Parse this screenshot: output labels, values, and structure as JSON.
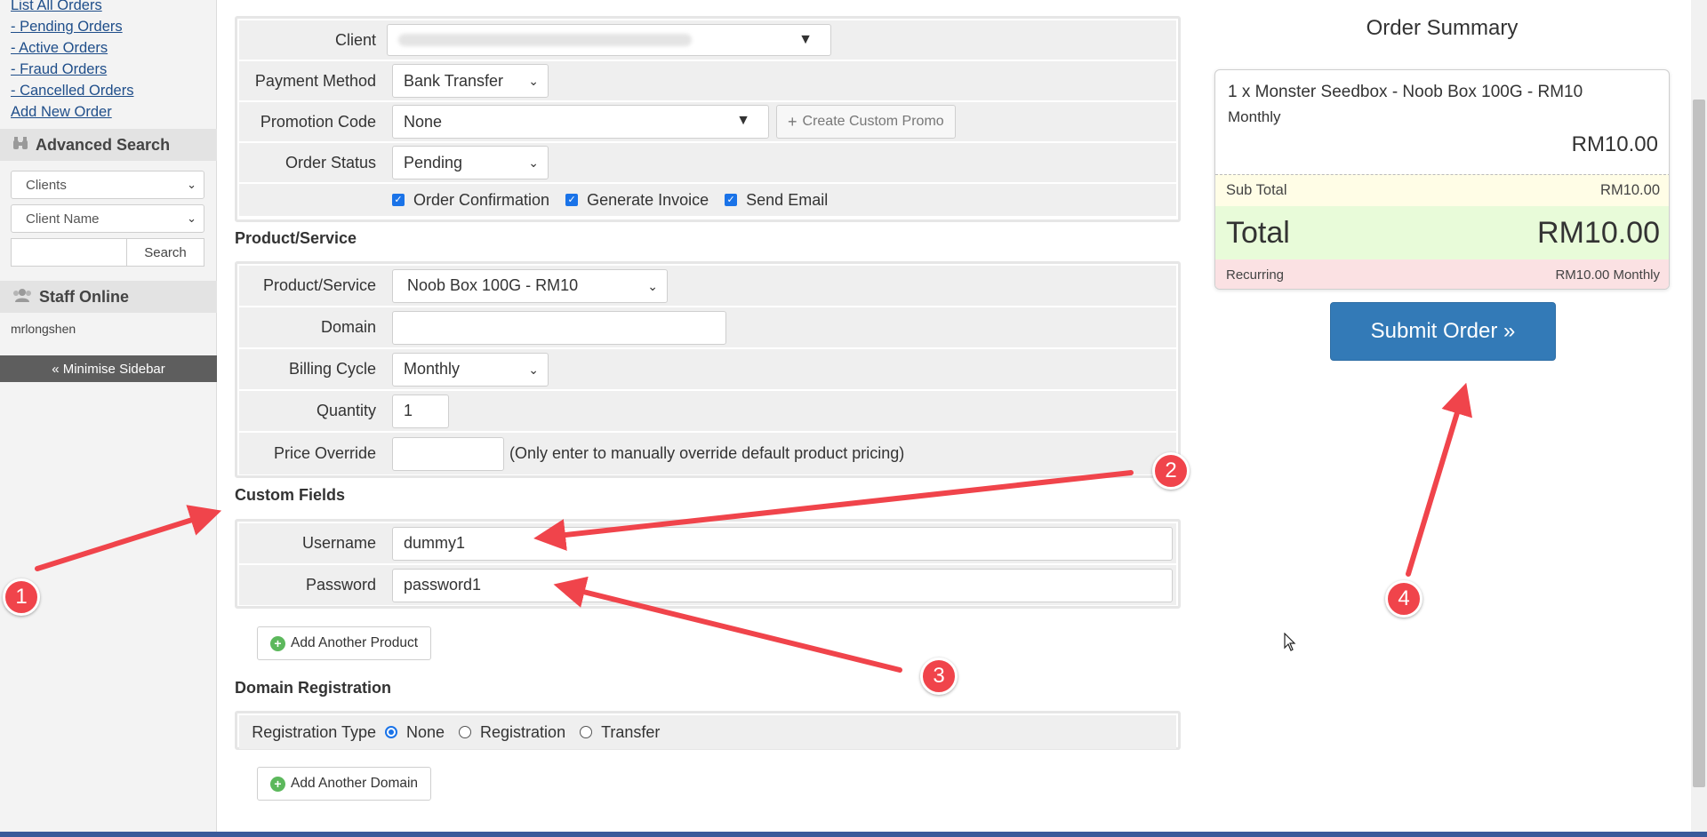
{
  "sidebar": {
    "links": [
      "List All Orders",
      "- Pending Orders",
      "- Active Orders",
      "- Fraud Orders",
      "- Cancelled Orders",
      "Add New Order"
    ],
    "advanced_search": "Advanced Search",
    "search_type": "Clients",
    "search_field": "Client Name",
    "search_button": "Search",
    "staff_online": "Staff Online",
    "staff_user": "mrlongshen",
    "minimise": "« Minimise Sidebar"
  },
  "form": {
    "client_label": "Client",
    "payment_label": "Payment Method",
    "payment_value": "Bank Transfer",
    "promo_label": "Promotion Code",
    "promo_value": "None",
    "custom_promo": "Create Custom Promo",
    "status_label": "Order Status",
    "status_value": "Pending",
    "checks": [
      "Order Confirmation",
      "Generate Invoice",
      "Send Email"
    ]
  },
  "product": {
    "section": "Product/Service",
    "product_label": "Product/Service",
    "product_value": "Noob Box 100G - RM10",
    "domain_label": "Domain",
    "billing_label": "Billing Cycle",
    "billing_value": "Monthly",
    "quantity_label": "Quantity",
    "quantity_value": "1",
    "override_label": "Price Override",
    "override_note": "(Only enter to manually override default product pricing)"
  },
  "custom_fields": {
    "section": "Custom Fields",
    "username_label": "Username",
    "username_value": "dummy1",
    "password_label": "Password",
    "password_value": "password1"
  },
  "add_product": "Add Another Product",
  "domain_reg": {
    "section": "Domain Registration",
    "type_label": "Registration Type",
    "options": [
      "None",
      "Registration",
      "Transfer"
    ]
  },
  "add_domain": "Add Another Domain",
  "summary": {
    "title": "Order Summary",
    "item": "1 x Monster Seedbox - Noob Box 100G - RM10",
    "cycle": "Monthly",
    "item_price": "RM10.00",
    "subtotal_label": "Sub Total",
    "subtotal_value": "RM10.00",
    "total_label": "Total",
    "total_value": "RM10.00",
    "recurring_label": "Recurring",
    "recurring_value": "RM10.00 Monthly",
    "submit": "Submit Order »"
  },
  "annotations": [
    "1",
    "2",
    "3",
    "4"
  ],
  "colors": {
    "accent": "#337ab7",
    "annotation": "#f0444b"
  }
}
